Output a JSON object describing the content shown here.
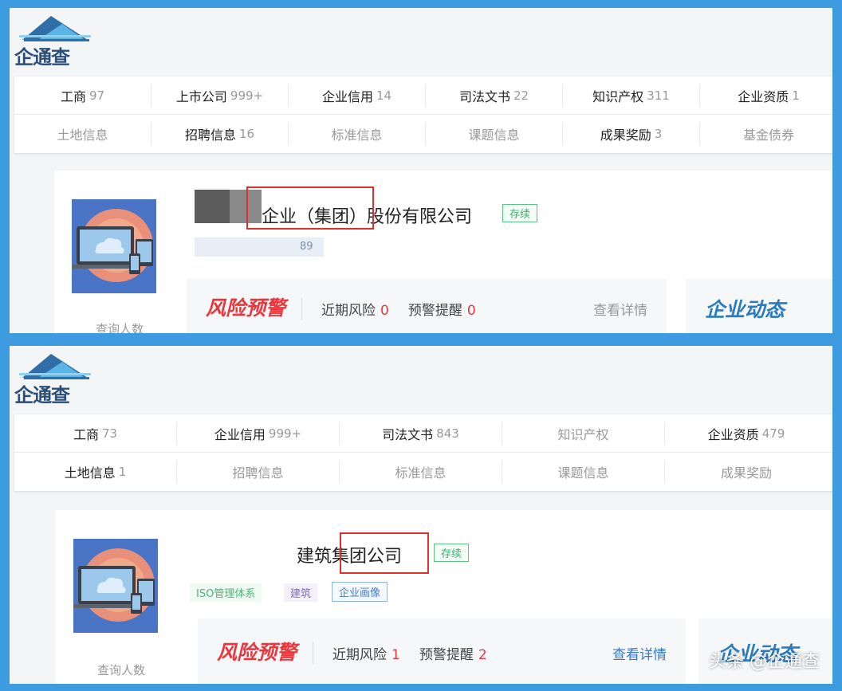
{
  "colors": {
    "frame": "#3d9be0",
    "risk_red": "#e8383d",
    "status_green": "#3db16a",
    "link_blue": "#3a78c9",
    "highlight_red": "#d8312e"
  },
  "logo_text": "企通查",
  "screen1": {
    "tabs_row1": [
      {
        "label": "工商",
        "count": "97",
        "dim": false
      },
      {
        "label": "上市公司",
        "count": "999+",
        "dim": false
      },
      {
        "label": "企业信用",
        "count": "14",
        "dim": false
      },
      {
        "label": "司法文书",
        "count": "22",
        "dim": false
      },
      {
        "label": "知识产权",
        "count": "311",
        "dim": false
      },
      {
        "label": "企业资质",
        "count": "1",
        "dim": false
      }
    ],
    "tabs_row2": [
      {
        "label": "土地信息",
        "count": "",
        "dim": true
      },
      {
        "label": "招聘信息",
        "count": "16",
        "dim": false
      },
      {
        "label": "标准信息",
        "count": "",
        "dim": true
      },
      {
        "label": "课题信息",
        "count": "",
        "dim": true
      },
      {
        "label": "成果奖励",
        "count": "3",
        "dim": false
      },
      {
        "label": "基金债券",
        "count": "",
        "dim": true
      }
    ],
    "company_name": "企业（集团）股份有限公司",
    "status": "存续",
    "sub_line": "89",
    "avatar_label": "查询人数",
    "risk_title": "风险预警",
    "recent_risk_label": "近期风险",
    "recent_risk_count": "0",
    "warning_label": "预警提醒",
    "warning_count": "0",
    "detail_link": "查看详情",
    "dynamic_title": "企业动态"
  },
  "screen2": {
    "tabs_row1": [
      {
        "label": "工商",
        "count": "73",
        "dim": false
      },
      {
        "label": "企业信用",
        "count": "999+",
        "dim": false
      },
      {
        "label": "司法文书",
        "count": "843",
        "dim": false
      },
      {
        "label": "知识产权",
        "count": "",
        "dim": true
      },
      {
        "label": "企业资质",
        "count": "479",
        "dim": false
      }
    ],
    "tabs_row2": [
      {
        "label": "土地信息",
        "count": "1",
        "dim": false
      },
      {
        "label": "招聘信息",
        "count": "",
        "dim": true
      },
      {
        "label": "标准信息",
        "count": "",
        "dim": true
      },
      {
        "label": "课题信息",
        "count": "",
        "dim": true
      },
      {
        "label": "成果奖励",
        "count": "",
        "dim": true
      }
    ],
    "company_name": "建筑集团公司",
    "status": "存续",
    "tags": [
      "ISO管理体系",
      "建筑",
      "企业画像"
    ],
    "avatar_label": "查询人数",
    "risk_title": "风险预警",
    "recent_risk_label": "近期风险",
    "recent_risk_count": "1",
    "warning_label": "预警提醒",
    "warning_count": "2",
    "detail_link": "查看详情",
    "dynamic_title": "企业动态"
  },
  "watermark": "头条 @企通查"
}
